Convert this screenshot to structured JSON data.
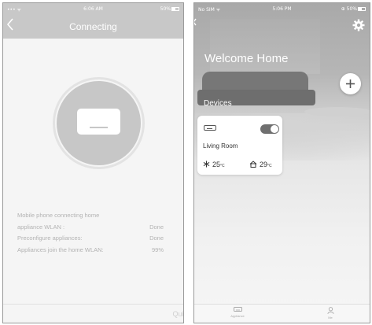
{
  "left_screen": {
    "status": {
      "signal": "••• ᯤ",
      "time": "6:06 AM",
      "battery": "50%"
    },
    "nav": {
      "back": "‹",
      "title": "Connecting"
    },
    "progress": [
      {
        "label": "Mobile phone connecting home",
        "value": ""
      },
      {
        "label": "appliance WLAN :",
        "value": "Done"
      },
      {
        "label": "Preconfigure appliances:",
        "value": "Done"
      },
      {
        "label": "Appliances join the home WLAN:",
        "value": "99%"
      }
    ],
    "quit_label": "Quit"
  },
  "right_screen": {
    "status": {
      "signal": "No SIM ᯤ",
      "time": "5:06 PM",
      "battery": "⊕ 50%"
    },
    "welcome": "Welcome Home",
    "devices_label": "Devices",
    "device": {
      "name": "Living Room",
      "set_temp": "25",
      "indoor_temp": "29",
      "unit": "°C",
      "power_on": true
    },
    "tabs": [
      {
        "label": "Appliance",
        "icon": "appliance-icon"
      },
      {
        "label": "Me",
        "icon": "person-icon"
      }
    ]
  }
}
